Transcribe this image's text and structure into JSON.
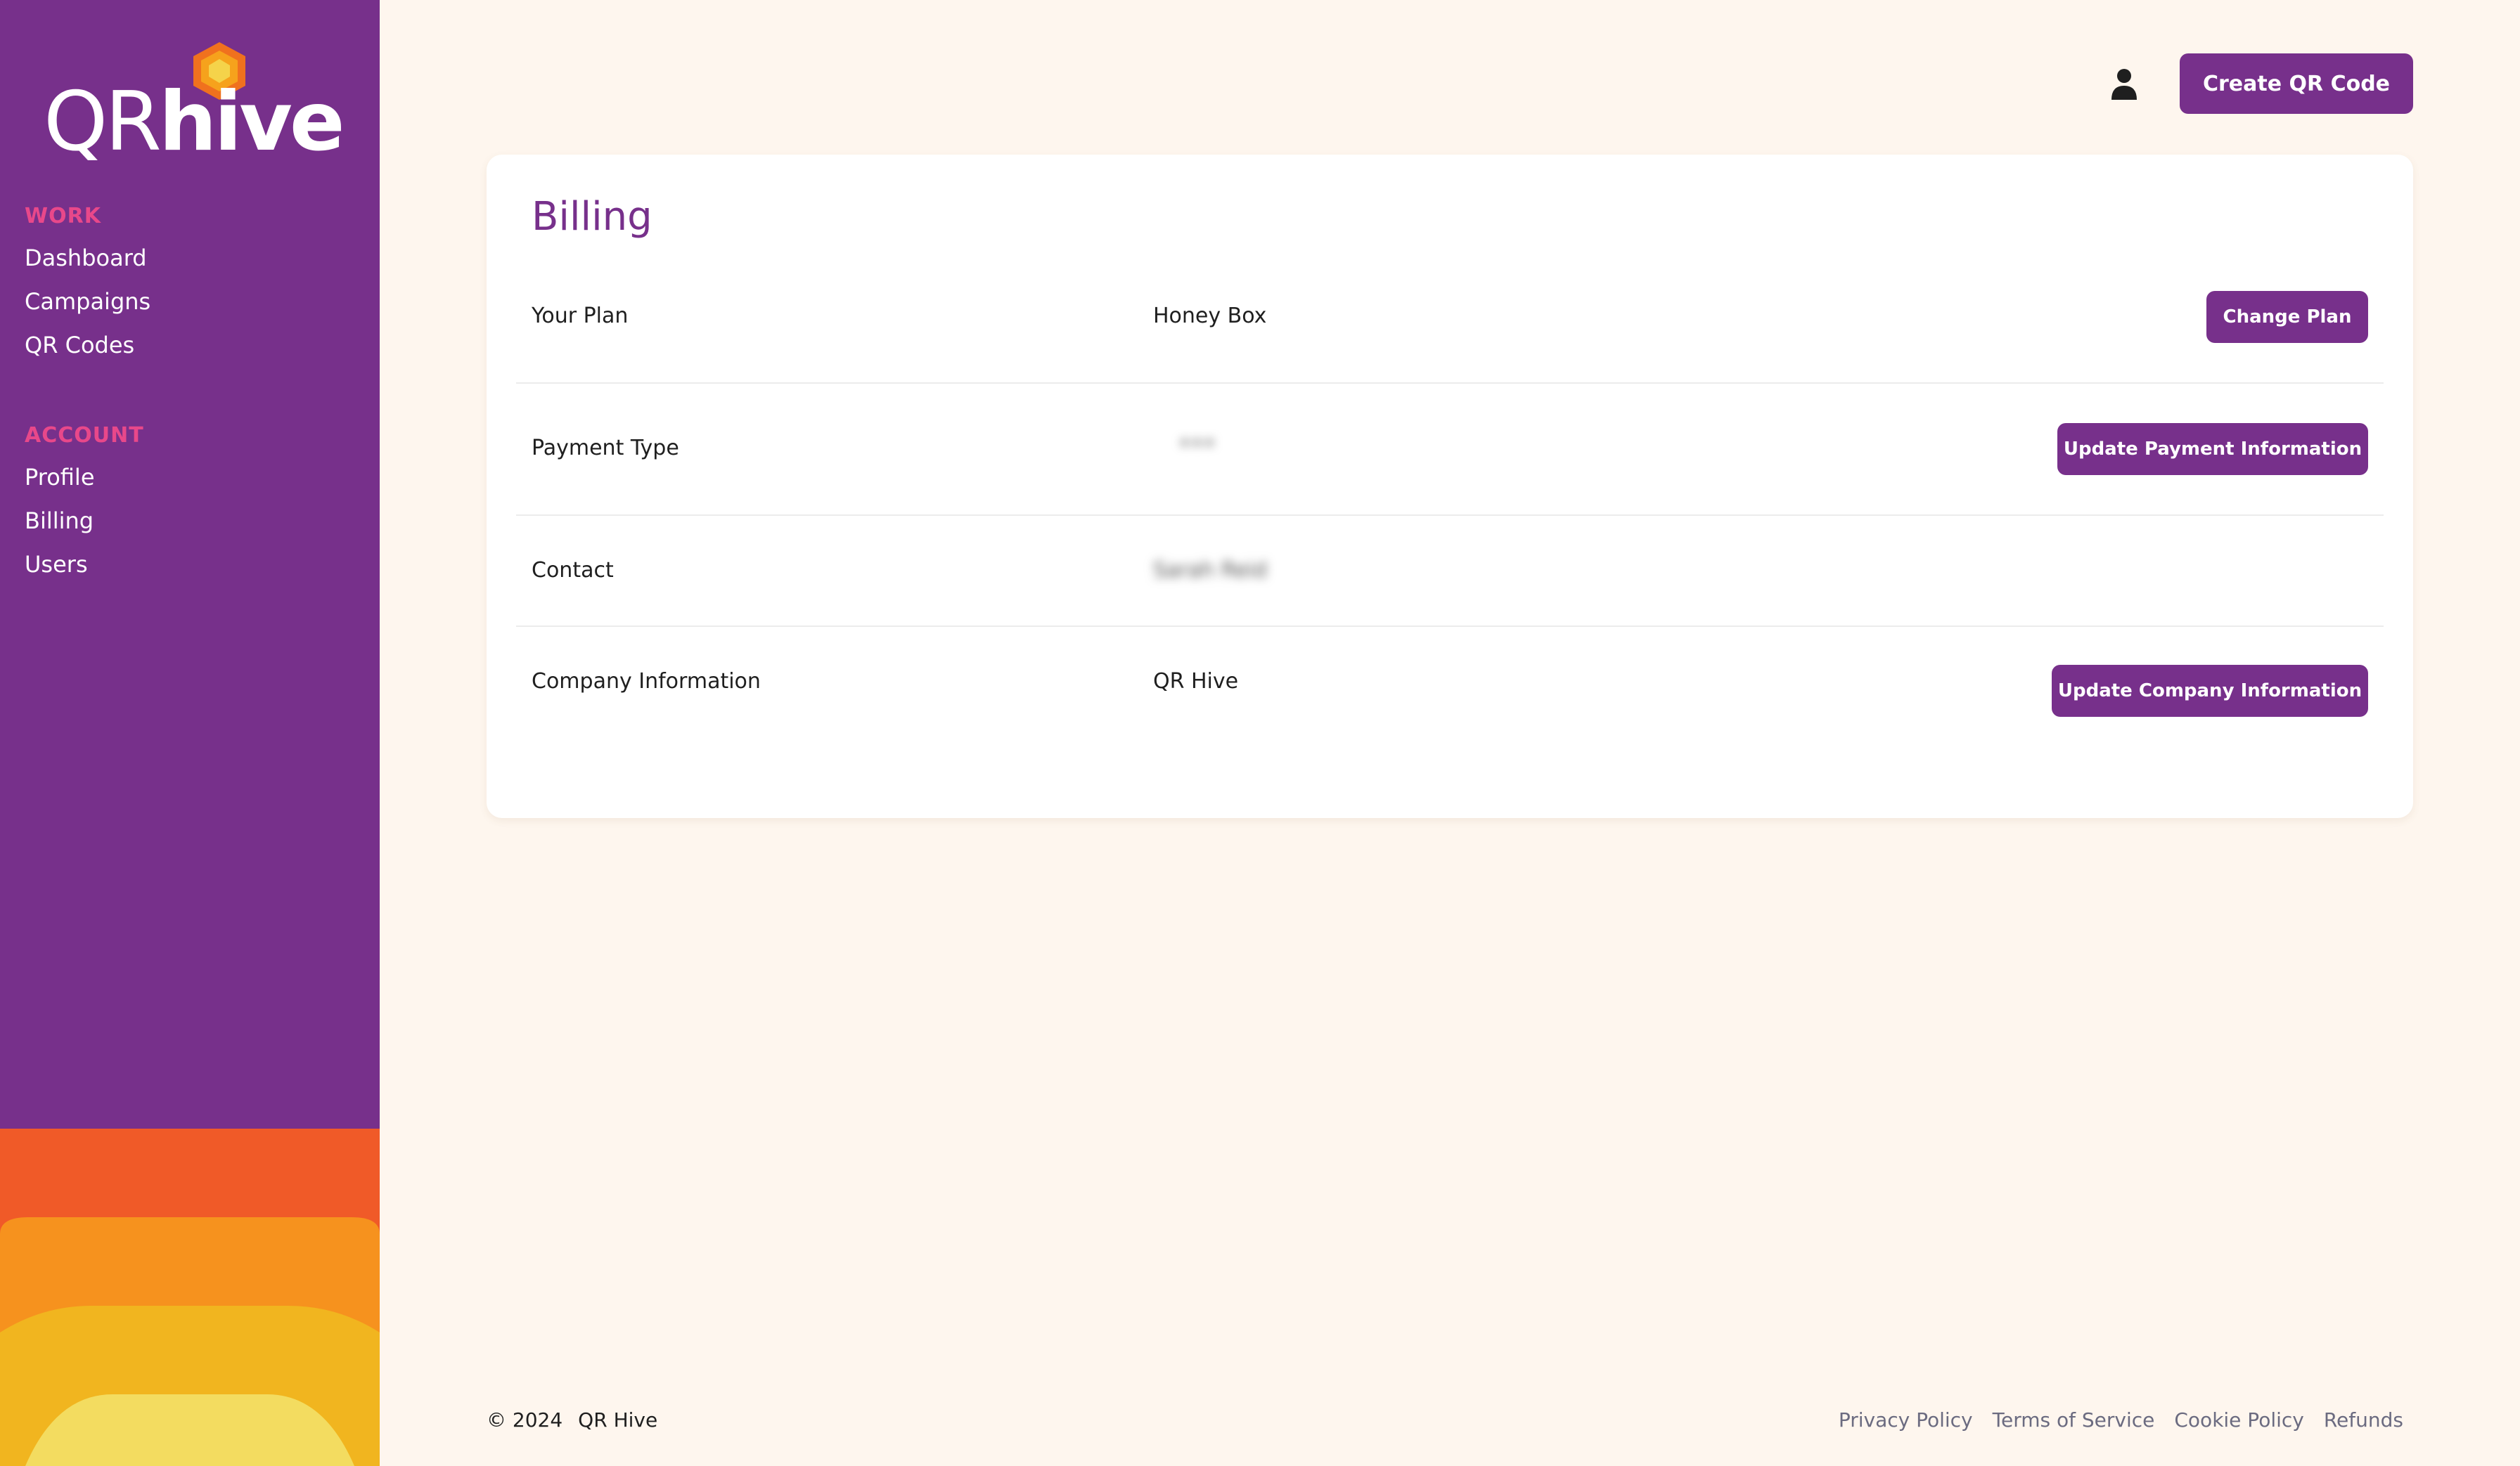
{
  "brand": {
    "logo_qr": "QR",
    "logo_hive": "hive",
    "purple": "#77308b",
    "accent_pink": "#e8488a",
    "background": "#fef6ee"
  },
  "sidebar": {
    "sections": [
      {
        "label": "WORK",
        "items": [
          "Dashboard",
          "Campaigns",
          "QR Codes"
        ]
      },
      {
        "label": "ACCOUNT",
        "items": [
          "Profile",
          "Billing",
          "Users"
        ]
      }
    ]
  },
  "header": {
    "user_icon": "user-icon",
    "create_button": "Create QR Code"
  },
  "billing": {
    "title": "Billing",
    "rows": [
      {
        "label": "Your Plan",
        "value": "Honey Box",
        "button": "Change Plan"
      },
      {
        "label": "Payment Type",
        "value": "•••",
        "button": "Update Payment Information"
      },
      {
        "label": "Contact",
        "value": "Sarah Reid",
        "button": ""
      },
      {
        "label": "Company Information",
        "value": "QR Hive",
        "button": "Update Company Information"
      }
    ]
  },
  "footer": {
    "copyright": "© 2024",
    "company": "QR Hive",
    "links": [
      "Privacy Policy",
      "Terms of Service",
      "Cookie Policy",
      "Refunds"
    ]
  }
}
